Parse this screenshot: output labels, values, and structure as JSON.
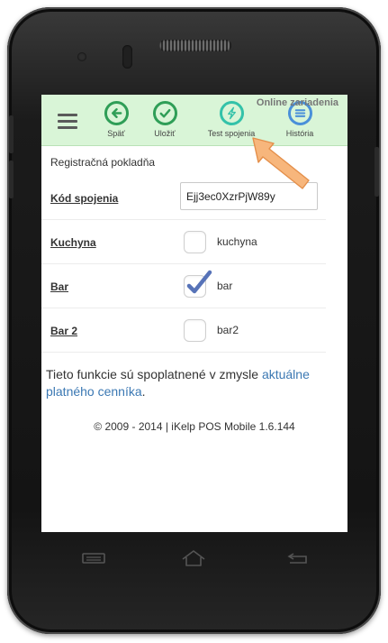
{
  "toolbar": {
    "online_label": "Online zariadenia",
    "items": [
      {
        "label": "Späť",
        "icon": "arrow-left-icon"
      },
      {
        "label": "Uložiť",
        "icon": "checkmark-icon"
      },
      {
        "label": "Test spojenia",
        "icon": "lightning-icon"
      },
      {
        "label": "História",
        "icon": "list-icon"
      }
    ]
  },
  "section_title": "Registračná pokladňa",
  "connection": {
    "label": "Kód spojenia",
    "value": "Ejj3ec0XzrPjW89y"
  },
  "printers": [
    {
      "label": "Kuchyna",
      "checkbox_label": "kuchyna",
      "checked": false
    },
    {
      "label": "Bar",
      "checkbox_label": "bar",
      "checked": true
    },
    {
      "label": "Bar 2",
      "checkbox_label": "bar2",
      "checked": false
    }
  ],
  "info": {
    "text": "Tieto funkcie sú spoplatnené v zmysle ",
    "link": "aktuálne platného cenníka",
    "suffix": "."
  },
  "footer": "© 2009 - 2014 | iKelp POS Mobile 1.6.144",
  "colors": {
    "toolbar_bg": "#d9f5d7",
    "icon_green": "#2f9e57",
    "test_icon": "#33c2a9",
    "history_icon": "#4a90d9",
    "link": "#3b78b3",
    "arrow": "#f7b67c"
  }
}
